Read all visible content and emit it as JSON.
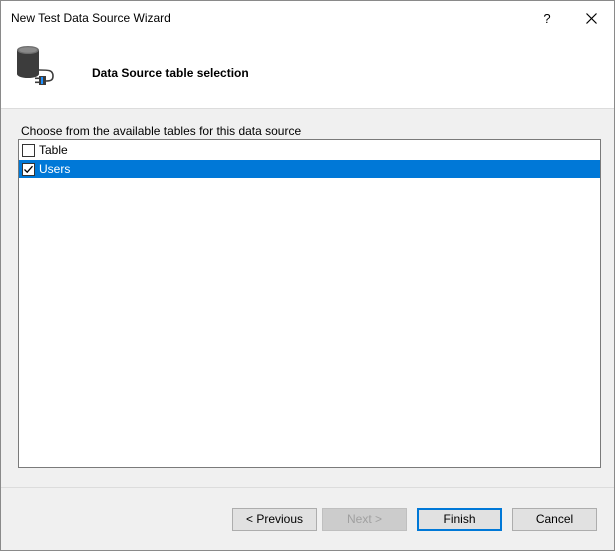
{
  "window": {
    "title": "New Test Data Source Wizard",
    "help_label": "?"
  },
  "header": {
    "title": "Data Source table selection",
    "icon": "database-plug-icon"
  },
  "main": {
    "instructions": "Choose from the available tables for this data source",
    "tables": [
      {
        "label": "Table",
        "checked": false,
        "selected": false
      },
      {
        "label": "Users",
        "checked": true,
        "selected": true
      }
    ]
  },
  "buttons": {
    "previous": "< Previous",
    "next": "Next >",
    "finish": "Finish",
    "cancel": "Cancel"
  },
  "colors": {
    "selection": "#0078d7",
    "default_button_border": "#0078d7"
  }
}
